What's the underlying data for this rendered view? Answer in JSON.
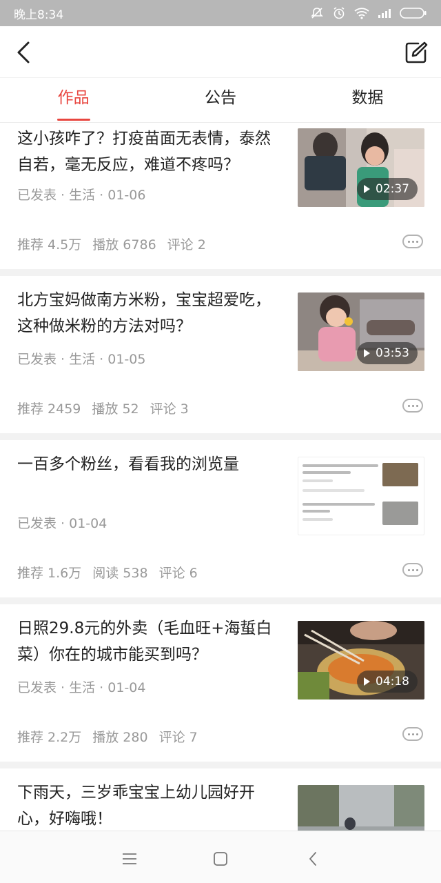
{
  "status_bar": {
    "time": "晚上8:34"
  },
  "tabs": [
    {
      "label": "作品",
      "active": true
    },
    {
      "label": "公告",
      "active": false
    },
    {
      "label": "数据",
      "active": false
    }
  ],
  "items": [
    {
      "title": "这小孩咋了？打疫苗面无表情，泰然自若，毫无反应，难道不疼吗？",
      "meta": "已发表 · 生活 · 01-06",
      "stats": [
        "推荐 4.5万",
        "播放 6786",
        "评论 2"
      ],
      "duration": "02:37",
      "thumb": "video"
    },
    {
      "title": "北方宝妈做南方米粉，宝宝超爱吃，这种做米粉的方法对吗？",
      "meta": "已发表 · 生活 · 01-05",
      "stats": [
        "推荐 2459",
        "播放 52",
        "评论 3"
      ],
      "duration": "03:53",
      "thumb": "video"
    },
    {
      "title": "一百多个粉丝，看看我的浏览量",
      "meta": "已发表 · 01-04",
      "stats": [
        "推荐 1.6万",
        "阅读 538",
        "评论 6"
      ],
      "duration": "",
      "thumb": "screenshot"
    },
    {
      "title": "日照29.8元的外卖（毛血旺+海蜇白菜）你在的城市能买到吗？",
      "meta": "已发表 · 生活 · 01-04",
      "stats": [
        "推荐 2.2万",
        "播放 280",
        "评论 7"
      ],
      "duration": "04:18",
      "thumb": "video"
    },
    {
      "title": "下雨天，三岁乖宝宝上幼儿园好开心，好嗨哦！",
      "meta": "",
      "stats": [],
      "duration": "",
      "thumb": "video"
    }
  ],
  "colors": {
    "accent": "#e8463f",
    "meta_text": "#999999",
    "separator": "#f2f2f2",
    "status_bar": "#b7b7b7"
  },
  "icons": [
    "back-arrow-icon",
    "edit-icon",
    "more-icon",
    "play-icon",
    "menu-icon",
    "home-square-icon",
    "back-chevron-icon"
  ]
}
